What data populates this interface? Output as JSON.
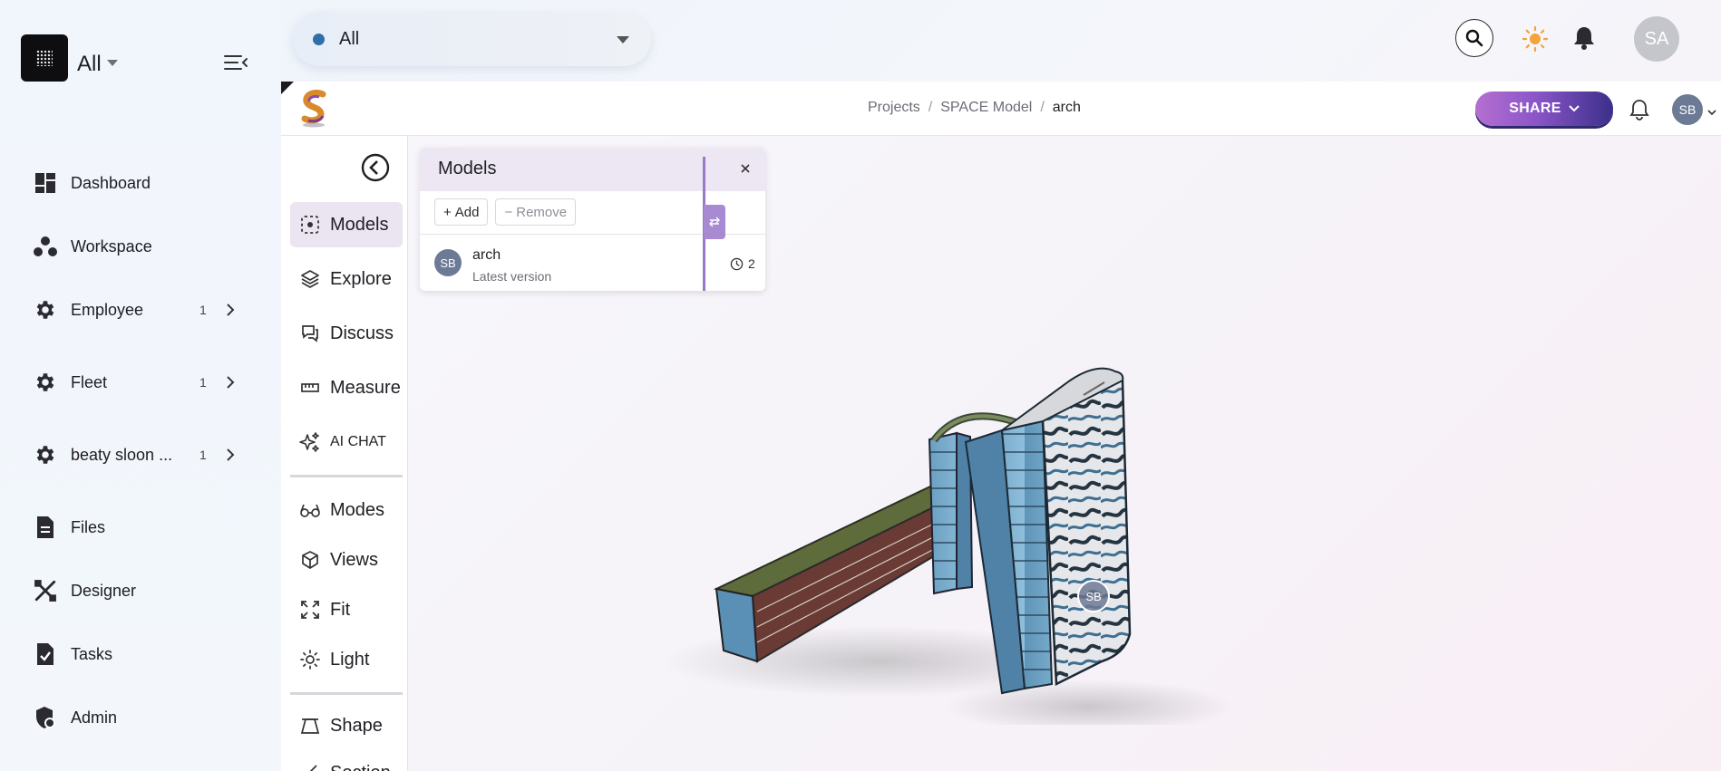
{
  "org": {
    "name": "All"
  },
  "nav": {
    "items": [
      {
        "label": "Dashboard",
        "icon": "dashboard-icon"
      },
      {
        "label": "Workspace",
        "icon": "workspace-icon"
      },
      {
        "label": "Employee",
        "icon": "gear-icon",
        "count": "1"
      },
      {
        "label": "Fleet",
        "icon": "gear-icon",
        "count": "1"
      },
      {
        "label": "beaty sloon ...",
        "icon": "gear-icon",
        "count": "1"
      },
      {
        "label": "Files",
        "icon": "file-icon"
      },
      {
        "label": "Designer",
        "icon": "designer-icon"
      },
      {
        "label": "Tasks",
        "icon": "tasks-icon"
      },
      {
        "label": "Admin",
        "icon": "admin-icon"
      }
    ]
  },
  "topbar": {
    "scope_value": "All",
    "avatar_initials": "SA"
  },
  "viewer": {
    "breadcrumb": [
      "Projects",
      "SPACE Model",
      "arch"
    ],
    "share_label": "SHARE",
    "avatar_initials": "SB",
    "tools": [
      {
        "label": "Models",
        "icon": "models-icon",
        "active": true
      },
      {
        "label": "Explore",
        "icon": "layers-icon"
      },
      {
        "label": "Discuss",
        "icon": "chat-icon"
      },
      {
        "label": "Measure",
        "icon": "ruler-icon"
      },
      {
        "label": "AI CHAT",
        "icon": "sparkle-icon"
      },
      {
        "label": "Modes",
        "icon": "glasses-icon"
      },
      {
        "label": "Views",
        "icon": "cube-views-icon"
      },
      {
        "label": "Fit",
        "icon": "fit-icon"
      },
      {
        "label": "Light",
        "icon": "light-icon"
      },
      {
        "label": "Shape",
        "icon": "shape-icon"
      },
      {
        "label": "Section",
        "icon": "section-icon"
      }
    ],
    "models_panel": {
      "title": "Models",
      "add_label": "Add",
      "remove_label": "Remove",
      "model": {
        "name": "arch",
        "subtitle": "Latest version",
        "avatar": "SB",
        "versions": "2"
      }
    },
    "scene_marker": "SB"
  },
  "colors": {
    "accent": "#8a55c8",
    "avatar": "#6d7a95",
    "panel_header": "#ece7f3"
  }
}
